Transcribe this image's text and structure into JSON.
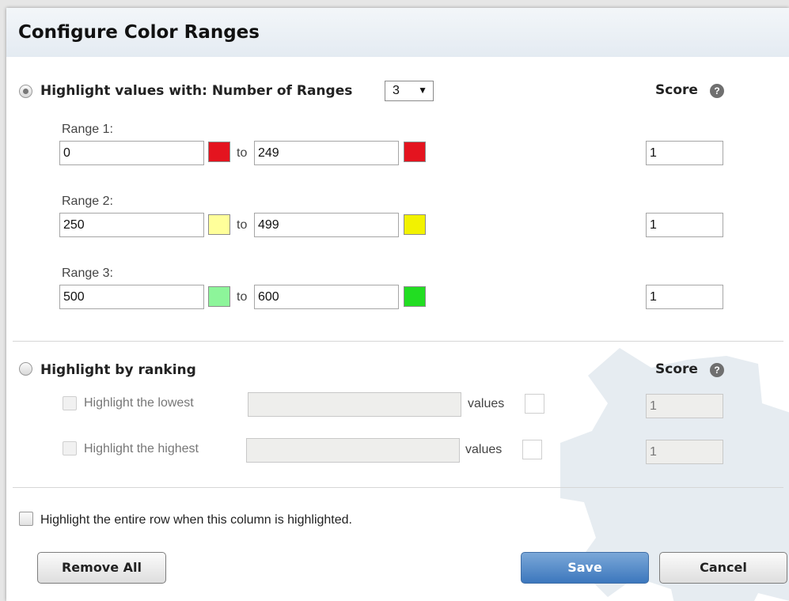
{
  "dialog": {
    "title": "Configure Color Ranges"
  },
  "ranges_section": {
    "radio_label": "Highlight values with: Number of Ranges",
    "num_ranges": "3",
    "score_label": "Score",
    "help_glyph": "?",
    "to_label": "to",
    "ranges": [
      {
        "label": "Range 1:",
        "from": "0",
        "to": "249",
        "from_color": "#e4141f",
        "to_color": "#e4141f",
        "score": "1"
      },
      {
        "label": "Range 2:",
        "from": "250",
        "to": "499",
        "from_color": "#ffff9a",
        "to_color": "#f2f200",
        "score": "1"
      },
      {
        "label": "Range 3:",
        "from": "500",
        "to": "600",
        "from_color": "#8df59a",
        "to_color": "#22dd22",
        "score": "1"
      }
    ]
  },
  "ranking_section": {
    "radio_label": "Highlight by ranking",
    "score_label": "Score",
    "help_glyph": "?",
    "lowest": {
      "label": "Highlight the lowest",
      "value": "",
      "values_label": "values",
      "score": "1"
    },
    "highest": {
      "label": "Highlight the highest",
      "value": "",
      "values_label": "values",
      "score": "1"
    }
  },
  "entire_row_label": "Highlight the entire row when this column is highlighted.",
  "buttons": {
    "remove_all": "Remove All",
    "save": "Save",
    "cancel": "Cancel"
  },
  "icons": {
    "dropdown": "triangle-down-icon",
    "help": "question-circle-icon",
    "background": "gear-icon"
  }
}
